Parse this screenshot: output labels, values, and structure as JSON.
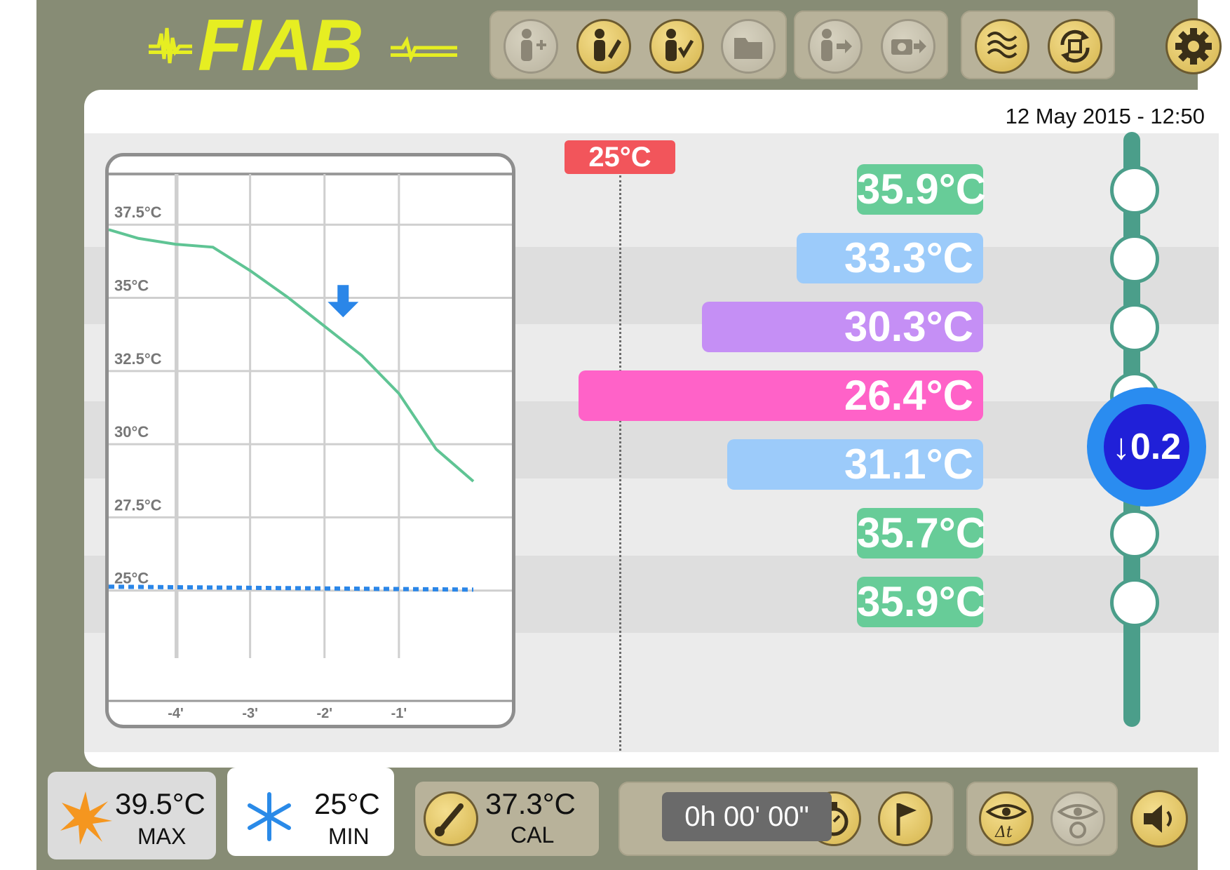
{
  "header": {
    "logo_text": "FIAB",
    "toolbar_groups": [
      {
        "buttons": [
          {
            "icon": "add-patient-icon",
            "enabled": false
          },
          {
            "icon": "edit-patient-icon",
            "enabled": true
          },
          {
            "icon": "select-patient-icon",
            "enabled": true
          },
          {
            "icon": "folder-icon",
            "enabled": false
          }
        ]
      },
      {
        "buttons": [
          {
            "icon": "export-patient-icon",
            "enabled": false
          },
          {
            "icon": "export-snapshot-icon",
            "enabled": false
          }
        ]
      },
      {
        "buttons": [
          {
            "icon": "waves-icon",
            "enabled": true
          },
          {
            "icon": "rotate-icon",
            "enabled": true
          }
        ]
      }
    ],
    "settings_icon": "gear-icon"
  },
  "datetime": "12 May 2015 - 12:50",
  "setpoint_label": "25°C",
  "readings": [
    {
      "label": "35.9°C",
      "value": 35.9,
      "color": "#67cc98"
    },
    {
      "label": "33.3°C",
      "value": 33.3,
      "color": "#9ccbfa"
    },
    {
      "label": "30.3°C",
      "value": 30.3,
      "color": "#c58ff5"
    },
    {
      "label": "26.4°C",
      "value": 26.4,
      "color": "#ff62c8"
    },
    {
      "label": "31.1°C",
      "value": 31.1,
      "color": "#9ccbfa"
    },
    {
      "label": "35.7°C",
      "value": 35.7,
      "color": "#67cc98"
    },
    {
      "label": "35.9°C",
      "value": 35.9,
      "color": "#67cc98"
    }
  ],
  "delta_label": "↓0.2",
  "chart_data": {
    "type": "line",
    "title": "",
    "xlabel": "",
    "ylabel": "",
    "x_ticks": [
      "-4'",
      "-3'",
      "-2'",
      "-1'"
    ],
    "y_ticks": [
      "37.5°C",
      "35°C",
      "32.5°C",
      "30°C",
      "27.5°C",
      "25°C"
    ],
    "xlim": [
      -4.9,
      0
    ],
    "ylim": [
      22.5,
      38.8
    ],
    "grid": true,
    "series": [
      {
        "x": [
          -4.9,
          -4.5,
          -4.0,
          -3.5,
          -3.0,
          -2.5,
          -2.2,
          -1.9,
          -1.5,
          -1.0,
          -0.5,
          0.0
        ],
        "y": [
          36.9,
          36.6,
          36.4,
          36.3,
          35.5,
          34.6,
          34.0,
          33.4,
          32.6,
          31.3,
          29.4,
          28.3
        ],
        "color": "#5fc494"
      },
      {
        "x": [
          -4.9,
          0.0
        ],
        "y": [
          24.7,
          24.6
        ],
        "color": "#2a86e8",
        "style": "dotted"
      }
    ],
    "marker": {
      "x": -1.75,
      "y": 34.0,
      "icon": "down-arrow-icon",
      "color": "#2a86e8"
    }
  },
  "stats": {
    "max": {
      "value": "39.5°C",
      "label": "MAX",
      "icon": "sun-icon"
    },
    "min": {
      "value": "25°C",
      "label": "MIN",
      "icon": "snowflake-icon"
    },
    "cal": {
      "value": "37.3°C",
      "label": "CAL",
      "icon": "thermometer-icon"
    }
  },
  "timer": "0h 00' 00\"",
  "bottom_icons": [
    "stopwatch-icon",
    "flag-icon",
    "eye-delta-icon",
    "eye-timer-icon",
    "speaker-icon"
  ]
}
